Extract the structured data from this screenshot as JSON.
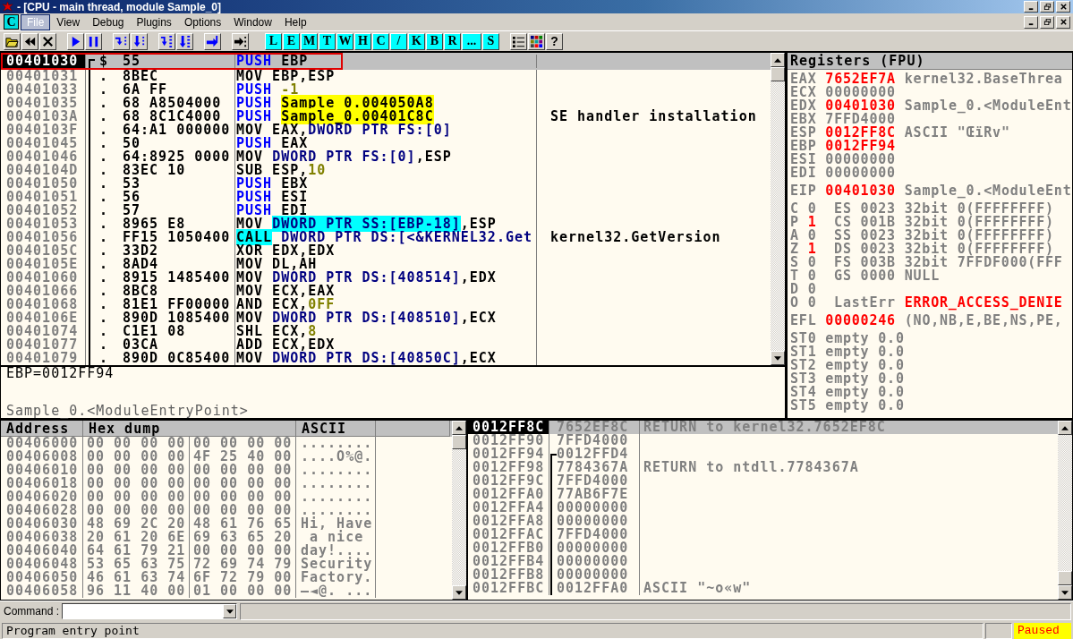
{
  "window": {
    "title": "- [CPU - main thread, module Sample_0]"
  },
  "menu": {
    "logo": "C",
    "items": [
      {
        "label": "File",
        "selected": true
      },
      {
        "label": "View",
        "selected": false
      },
      {
        "label": "Debug",
        "selected": false
      },
      {
        "label": "Plugins",
        "selected": false
      },
      {
        "label": "Options",
        "selected": false
      },
      {
        "label": "Window",
        "selected": false
      },
      {
        "label": "Help",
        "selected": false
      }
    ]
  },
  "toolbar": {
    "window_buttons": [
      "L",
      "E",
      "M",
      "T",
      "W",
      "H",
      "C",
      "/",
      "K",
      "B",
      "R",
      "...",
      "S"
    ],
    "help": "?"
  },
  "disassembly": {
    "rows": [
      {
        "address": "00401030",
        "marker": "$",
        "frame_start": true,
        "hex": "55",
        "instruction": [
          {
            "text": "PUSH",
            "kind": "kw"
          },
          {
            "text": " EBP"
          }
        ],
        "selected": true,
        "framed": true
      },
      {
        "address": "00401031",
        "marker": ".",
        "frame_start": false,
        "hex": "8BEC",
        "instruction": [
          {
            "text": "MOV EBP,ESP"
          }
        ],
        "selected": false,
        "framed": false
      },
      {
        "address": "00401033",
        "marker": ".",
        "frame_start": false,
        "hex": "6A FF",
        "instruction": [
          {
            "text": "PUSH ",
            "kind": "kw"
          },
          {
            "text": "-1",
            "kind": "num"
          }
        ],
        "selected": false,
        "framed": false
      },
      {
        "address": "00401035",
        "marker": ".",
        "frame_start": false,
        "hex": "68 A8504000",
        "instruction": [
          {
            "text": "PUSH ",
            "kind": "kw"
          },
          {
            "text": "Sample_0.004050A8",
            "kind": "label"
          }
        ],
        "selected": false,
        "framed": false
      },
      {
        "address": "0040103A",
        "marker": ".",
        "frame_start": false,
        "hex": "68 8C1C4000",
        "instruction": [
          {
            "text": "PUSH ",
            "kind": "kw"
          },
          {
            "text": "Sample_0.00401C8C",
            "kind": "label"
          }
        ],
        "comment": "SE handler installation",
        "selected": false,
        "framed": false
      },
      {
        "address": "0040103F",
        "marker": ".",
        "frame_start": false,
        "hex": "64:A1 000000",
        "instruction": [
          {
            "text": "MOV EAX,"
          },
          {
            "text": "DWORD PTR FS:[0]",
            "kind": "ptr"
          }
        ],
        "selected": false,
        "framed": false
      },
      {
        "address": "00401045",
        "marker": ".",
        "frame_start": false,
        "hex": "50",
        "instruction": [
          {
            "text": "PUSH",
            "kind": "kw"
          },
          {
            "text": " EAX"
          }
        ],
        "selected": false,
        "framed": false
      },
      {
        "address": "00401046",
        "marker": ".",
        "frame_start": false,
        "hex": "64:8925 0000",
        "instruction": [
          {
            "text": "MOV "
          },
          {
            "text": "DWORD PTR FS:[0]",
            "kind": "ptr"
          },
          {
            "text": ",ESP"
          }
        ],
        "selected": false,
        "framed": false
      },
      {
        "address": "0040104D",
        "marker": ".",
        "frame_start": false,
        "hex": "83EC 10",
        "instruction": [
          {
            "text": "SUB ESP,"
          },
          {
            "text": "10",
            "kind": "num"
          }
        ],
        "selected": false,
        "framed": false
      },
      {
        "address": "00401050",
        "marker": ".",
        "frame_start": false,
        "hex": "53",
        "instruction": [
          {
            "text": "PUSH",
            "kind": "kw"
          },
          {
            "text": " EBX"
          }
        ],
        "selected": false,
        "framed": false
      },
      {
        "address": "00401051",
        "marker": ".",
        "frame_start": false,
        "hex": "56",
        "instruction": [
          {
            "text": "PUSH",
            "kind": "kw"
          },
          {
            "text": " ESI"
          }
        ],
        "selected": false,
        "framed": false
      },
      {
        "address": "00401052",
        "marker": ".",
        "frame_start": false,
        "hex": "57",
        "instruction": [
          {
            "text": "PUSH",
            "kind": "kw"
          },
          {
            "text": " EDI"
          }
        ],
        "selected": false,
        "framed": false
      },
      {
        "address": "00401053",
        "marker": ".",
        "frame_start": false,
        "hex": "8965 E8",
        "instruction": [
          {
            "text": "MOV "
          },
          {
            "text": "DWORD PTR SS:[EBP-18]",
            "kind": "hlptr"
          },
          {
            "text": ",ESP"
          }
        ],
        "selected": false,
        "framed": false
      },
      {
        "address": "00401056",
        "marker": ".",
        "frame_start": false,
        "hex": "FF15 1050400",
        "instruction": [
          {
            "text": "CALL",
            "kind": "hl"
          },
          {
            "text": " DWORD PTR DS:[<&KERNEL32.Get",
            "kind": "ptr"
          }
        ],
        "comment": "kernel32.GetVersion",
        "selected": false,
        "framed": false
      },
      {
        "address": "0040105C",
        "marker": ".",
        "frame_start": false,
        "hex": "33D2",
        "instruction": [
          {
            "text": "XOR EDX,EDX"
          }
        ],
        "selected": false,
        "framed": false
      },
      {
        "address": "0040105E",
        "marker": ".",
        "frame_start": false,
        "hex": "8AD4",
        "instruction": [
          {
            "text": "MOV DL,AH"
          }
        ],
        "selected": false,
        "framed": false
      },
      {
        "address": "00401060",
        "marker": ".",
        "frame_start": false,
        "hex": "8915 1485400",
        "instruction": [
          {
            "text": "MOV "
          },
          {
            "text": "DWORD PTR DS:[408514]",
            "kind": "ptr"
          },
          {
            "text": ",EDX"
          }
        ],
        "selected": false,
        "framed": false
      },
      {
        "address": "00401066",
        "marker": ".",
        "frame_start": false,
        "hex": "8BC8",
        "instruction": [
          {
            "text": "MOV ECX,EAX"
          }
        ],
        "selected": false,
        "framed": false
      },
      {
        "address": "00401068",
        "marker": ".",
        "frame_start": false,
        "hex": "81E1 FF00000",
        "instruction": [
          {
            "text": "AND ECX,"
          },
          {
            "text": "0FF",
            "kind": "num"
          }
        ],
        "selected": false,
        "framed": false
      },
      {
        "address": "0040106E",
        "marker": ".",
        "frame_start": false,
        "hex": "890D 1085400",
        "instruction": [
          {
            "text": "MOV "
          },
          {
            "text": "DWORD PTR DS:[408510]",
            "kind": "ptr"
          },
          {
            "text": ",ECX"
          }
        ],
        "selected": false,
        "framed": false
      },
      {
        "address": "00401074",
        "marker": ".",
        "frame_start": false,
        "hex": "C1E1 08",
        "instruction": [
          {
            "text": "SHL ECX,"
          },
          {
            "text": "8",
            "kind": "num"
          }
        ],
        "selected": false,
        "framed": false
      },
      {
        "address": "00401077",
        "marker": ".",
        "frame_start": false,
        "hex": "03CA",
        "instruction": [
          {
            "text": "ADD ECX,EDX"
          }
        ],
        "selected": false,
        "framed": false
      },
      {
        "address": "00401079",
        "marker": ".",
        "frame_start": false,
        "hex": "890D 0C85400",
        "instruction": [
          {
            "text": "MOV "
          },
          {
            "text": "DWORD PTR DS:[40850C]",
            "kind": "ptr"
          },
          {
            "text": ",ECX"
          }
        ],
        "selected": false,
        "framed": false
      }
    ]
  },
  "info": {
    "lines": [
      "EBP=0012FF94",
      "Sample_0.<ModuleEntryPoint>"
    ]
  },
  "registers": {
    "title": "Registers (FPU)",
    "groups": [
      [
        {
          "kind": "reg",
          "name": "EAX",
          "value": "7652EF7A",
          "changed": true,
          "comment": "kernel32.BaseThrea"
        },
        {
          "kind": "reg",
          "name": "ECX",
          "value": "00000000",
          "changed": false
        },
        {
          "kind": "reg",
          "name": "EDX",
          "value": "00401030",
          "changed": true,
          "comment": "Sample_0.<ModuleEnt"
        },
        {
          "kind": "reg",
          "name": "EBX",
          "value": "7FFD4000",
          "changed": false
        },
        {
          "kind": "reg",
          "name": "ESP",
          "value": "0012FF8C",
          "changed": true,
          "comment": "ASCII \"ŒïRv\""
        },
        {
          "kind": "reg",
          "name": "EBP",
          "value": "0012FF94",
          "changed": true
        },
        {
          "kind": "reg",
          "name": "ESI",
          "value": "00000000",
          "changed": false
        },
        {
          "kind": "reg",
          "name": "EDI",
          "value": "00000000",
          "changed": false
        }
      ],
      [
        {
          "kind": "reg",
          "name": "EIP",
          "value": "00401030",
          "changed": true,
          "comment": "Sample_0.<ModuleEnt"
        }
      ],
      [
        {
          "kind": "flag",
          "name": "C",
          "value": "0",
          "changed": false,
          "segment": "ES 0023",
          "comment": "32bit 0(FFFFFFFF)"
        },
        {
          "kind": "flag",
          "name": "P",
          "value": "1",
          "changed": true,
          "segment": "CS 001B",
          "comment": "32bit 0(FFFFFFFF)"
        },
        {
          "kind": "flag",
          "name": "A",
          "value": "0",
          "changed": false,
          "segment": "SS 0023",
          "comment": "32bit 0(FFFFFFFF)"
        },
        {
          "kind": "flag",
          "name": "Z",
          "value": "1",
          "changed": true,
          "segment": "DS 0023",
          "comment": "32bit 0(FFFFFFFF)"
        },
        {
          "kind": "flag",
          "name": "S",
          "value": "0",
          "changed": false,
          "segment": "FS 003B",
          "comment": "32bit 7FFDF000(FFF"
        },
        {
          "kind": "flag",
          "name": "T",
          "value": "0",
          "changed": false,
          "segment": "GS 0000",
          "comment": "NULL"
        },
        {
          "kind": "flag",
          "name": "D",
          "value": "0",
          "changed": false
        },
        {
          "kind": "lasterr",
          "name": "O",
          "value": "0",
          "changed": false,
          "segment": "LastErr",
          "comment": "ERROR_ACCESS_DENIE"
        }
      ],
      [
        {
          "kind": "reg",
          "name": "EFL",
          "value": "00000246",
          "changed": true,
          "comment": "(NO,NB,E,BE,NS,PE,"
        }
      ],
      [
        {
          "kind": "fpu",
          "name": "ST0",
          "value": "empty 0.0"
        },
        {
          "kind": "fpu",
          "name": "ST1",
          "value": "empty 0.0"
        },
        {
          "kind": "fpu",
          "name": "ST2",
          "value": "empty 0.0"
        },
        {
          "kind": "fpu",
          "name": "ST3",
          "value": "empty 0.0"
        },
        {
          "kind": "fpu",
          "name": "ST4",
          "value": "empty 0.0"
        },
        {
          "kind": "fpu",
          "name": "ST5",
          "value": "empty 0.0"
        }
      ]
    ]
  },
  "dump": {
    "columns": [
      "Address",
      "Hex dump",
      "ASCII"
    ],
    "rows": [
      {
        "address": "00406000",
        "hex": [
          "00 00 00 00",
          "00 00 00 00"
        ],
        "ascii": "........"
      },
      {
        "address": "00406008",
        "hex": [
          "00 00 00 00",
          "4F 25 40 00"
        ],
        "ascii": "....O%@."
      },
      {
        "address": "00406010",
        "hex": [
          "00 00 00 00",
          "00 00 00 00"
        ],
        "ascii": "........"
      },
      {
        "address": "00406018",
        "hex": [
          "00 00 00 00",
          "00 00 00 00"
        ],
        "ascii": "........"
      },
      {
        "address": "00406020",
        "hex": [
          "00 00 00 00",
          "00 00 00 00"
        ],
        "ascii": "........"
      },
      {
        "address": "00406028",
        "hex": [
          "00 00 00 00",
          "00 00 00 00"
        ],
        "ascii": "........"
      },
      {
        "address": "00406030",
        "hex": [
          "48 69 2C 20",
          "48 61 76 65"
        ],
        "ascii": "Hi, Have"
      },
      {
        "address": "00406038",
        "hex": [
          "20 61 20 6E",
          "69 63 65 20"
        ],
        "ascii": " a nice"
      },
      {
        "address": "00406040",
        "hex": [
          "64 61 79 21",
          "00 00 00 00"
        ],
        "ascii": "day!...."
      },
      {
        "address": "00406048",
        "hex": [
          "53 65 63 75",
          "72 69 74 79"
        ],
        "ascii": "Security"
      },
      {
        "address": "00406050",
        "hex": [
          "46 61 63 74",
          "6F 72 79 00"
        ],
        "ascii": "Factory."
      },
      {
        "address": "00406058",
        "hex": [
          "96 11 40 00",
          "01 00 00 00"
        ],
        "ascii": "–◄@. ..."
      }
    ]
  },
  "stack": {
    "rows": [
      {
        "address": "0012FF8C",
        "value": "7652EF8C",
        "comment": "RETURN to kernel32.7652EF8C",
        "selected": true,
        "in_frame": false
      },
      {
        "address": "0012FF90",
        "value": "7FFD4000",
        "selected": false,
        "in_frame": false
      },
      {
        "address": "0012FF94",
        "value": "0012FFD4",
        "selected": false,
        "in_frame": true,
        "frame_start": true
      },
      {
        "address": "0012FF98",
        "value": "7784367A",
        "comment": "RETURN to ntdll.7784367A",
        "selected": false,
        "in_frame": true,
        "frame_start": false
      },
      {
        "address": "0012FF9C",
        "value": "7FFD4000",
        "selected": false,
        "in_frame": true,
        "frame_start": false
      },
      {
        "address": "0012FFA0",
        "value": "77AB6F7E",
        "selected": false,
        "in_frame": true,
        "frame_start": false
      },
      {
        "address": "0012FFA4",
        "value": "00000000",
        "selected": false,
        "in_frame": true,
        "frame_start": false
      },
      {
        "address": "0012FFA8",
        "value": "00000000",
        "selected": false,
        "in_frame": true,
        "frame_start": false
      },
      {
        "address": "0012FFAC",
        "value": "7FFD4000",
        "selected": false,
        "in_frame": true,
        "frame_start": false
      },
      {
        "address": "0012FFB0",
        "value": "00000000",
        "selected": false,
        "in_frame": true,
        "frame_start": false
      },
      {
        "address": "0012FFB4",
        "value": "00000000",
        "selected": false,
        "in_frame": true,
        "frame_start": false
      },
      {
        "address": "0012FFB8",
        "value": "00000000",
        "selected": false,
        "in_frame": true,
        "frame_start": false
      },
      {
        "address": "0012FFBC",
        "value": "0012FFA0",
        "comment": "ASCII \"~o«w\"",
        "selected": false,
        "in_frame": true,
        "frame_start": false
      }
    ]
  },
  "command": {
    "label": "Command :"
  },
  "status_bar": {
    "message": "Program entry point",
    "state": "Paused"
  }
}
